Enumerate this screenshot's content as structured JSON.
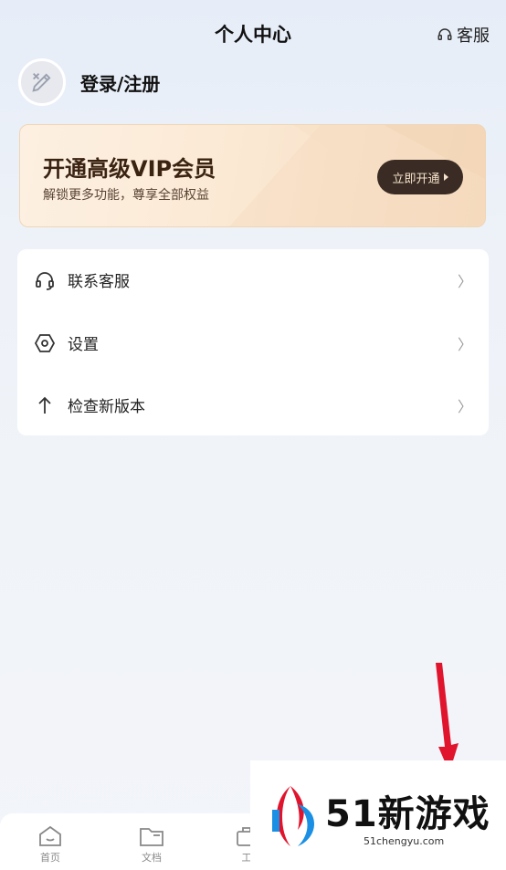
{
  "header": {
    "title": "个人中心",
    "service_label": "客服",
    "service_icon": "headset-icon"
  },
  "profile": {
    "login_label": "登录/注册",
    "avatar_icon": "pencil-ruler-icon"
  },
  "vip": {
    "title": "开通高级VIP会员",
    "subtitle": "解锁更多功能，尊享全部权益",
    "button_label": "立即开通"
  },
  "menu": {
    "items": [
      {
        "label": "联系客服",
        "icon": "headset-icon"
      },
      {
        "label": "设置",
        "icon": "hexagon-settings-icon"
      },
      {
        "label": "检查新版本",
        "icon": "arrow-up-icon"
      }
    ]
  },
  "tabbar": {
    "items": [
      {
        "label": "首页",
        "icon": "home-icon"
      },
      {
        "label": "文档",
        "icon": "folder-icon"
      },
      {
        "label": "工",
        "icon": "tools-icon"
      }
    ]
  },
  "watermark": {
    "brand": "51新游戏",
    "url": "51chengyu.com"
  },
  "colors": {
    "vip_button": "#3a2c24",
    "annotation_arrow": "#e0142c",
    "vip_title": "#3b2312"
  }
}
